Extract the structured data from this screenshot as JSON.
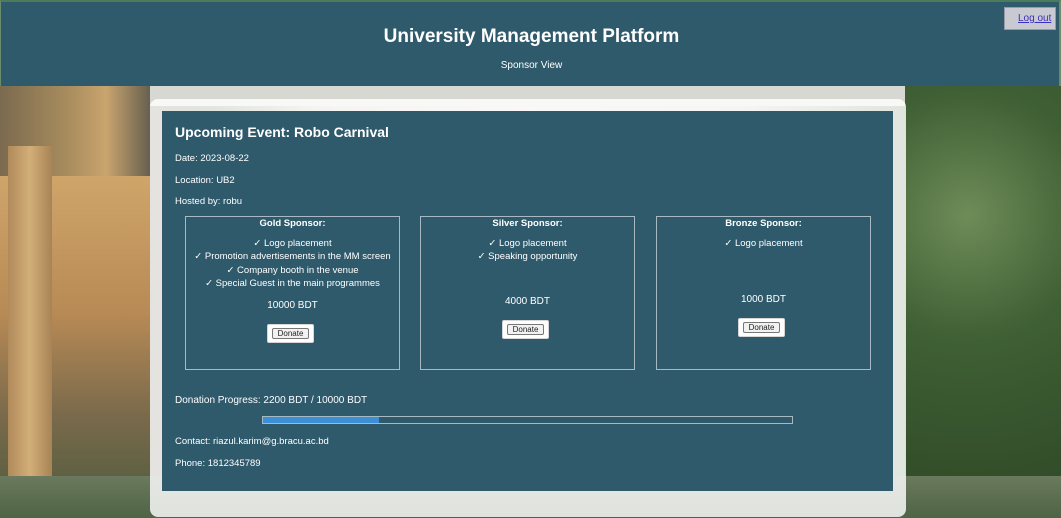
{
  "header": {
    "title": "University Management Platform",
    "subtitle": "Sponsor View",
    "logout_label": "Log out"
  },
  "event": {
    "title": "Upcoming Event: Robo Carnival",
    "date": "Date: 2023-08-22",
    "location": "Location: UB2",
    "hosted_by": "Hosted by: robu"
  },
  "sponsors": [
    {
      "title": "Gold Sponsor:",
      "benefits": [
        "✓ Logo placement",
        "✓ Promotion advertisements in the MM screen",
        "✓ Company booth in the venue",
        "✓ Special Guest in the main programmes"
      ],
      "price": "10000 BDT",
      "donate_label": "Donate"
    },
    {
      "title": "Silver Sponsor:",
      "benefits": [
        "✓ Logo placement",
        "✓ Speaking opportunity"
      ],
      "price": "4000 BDT",
      "donate_label": "Donate"
    },
    {
      "title": "Bronze Sponsor:",
      "benefits": [
        "✓ Logo placement"
      ],
      "price": "1000 BDT",
      "donate_label": "Donate"
    }
  ],
  "donation": {
    "label": "Donation Progress: 2200 BDT / 10000 BDT",
    "current": 2200,
    "goal": 10000
  },
  "contact": {
    "email": "Contact: riazul.karim@g.bracu.ac.bd",
    "phone": "Phone: 1812345789"
  },
  "colors": {
    "header_bg": "#2f5a6c",
    "progress_fill": "#3a8fd6"
  }
}
